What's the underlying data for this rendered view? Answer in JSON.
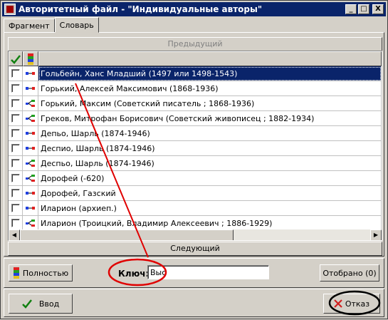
{
  "window": {
    "title": "Авторитетный файл - \"Индивидуальные авторы\""
  },
  "titlebar_buttons": {
    "minimize": "_",
    "maximize": "□",
    "close": "X"
  },
  "tabs": [
    {
      "label": "Фрагмент"
    },
    {
      "label": "Словарь"
    }
  ],
  "nav": {
    "prev_label": "Предыдущий",
    "next_label": "Следующий"
  },
  "rows": [
    {
      "label": "Гольбейн, Ханс Младший (1497 или 1498-1543)",
      "icon": "simple",
      "selected": true
    },
    {
      "label": "Горький, Алексей Максимович (1868-1936)",
      "icon": "simple"
    },
    {
      "label": "Горький, Максим (Советский писатель ; 1868-1936)",
      "icon": "tree"
    },
    {
      "label": "Греков, Митрофан Борисович (Советский живописец ; 1882-1934)",
      "icon": "tree"
    },
    {
      "label": "Депьо, Шарль (1874-1946)",
      "icon": "simple"
    },
    {
      "label": "Деспио, Шарль (1874-1946)",
      "icon": "simple"
    },
    {
      "label": "Деспьо, Шарль (1874-1946)",
      "icon": "tree"
    },
    {
      "label": "Дорофей (-620)",
      "icon": "tree"
    },
    {
      "label": "Дорофей, Газский",
      "icon": "simple"
    },
    {
      "label": "Иларион (архиеп.)",
      "icon": "simple"
    },
    {
      "label": "Иларион (Троицкий, Владимир Алексеевич ; 1886-1929)",
      "icon": "tree"
    }
  ],
  "bottom": {
    "full_button_label": "Полностью",
    "key_label": "Ключ:",
    "key_value": "Выс",
    "selected_button_label": "Отобрано (0)"
  },
  "footer": {
    "enter_label": "Ввод",
    "cancel_label": "Отказ"
  },
  "colors": {
    "title_bg": "#0a246a",
    "highlight": "#0a246a",
    "annotation_red": "#e00000"
  }
}
